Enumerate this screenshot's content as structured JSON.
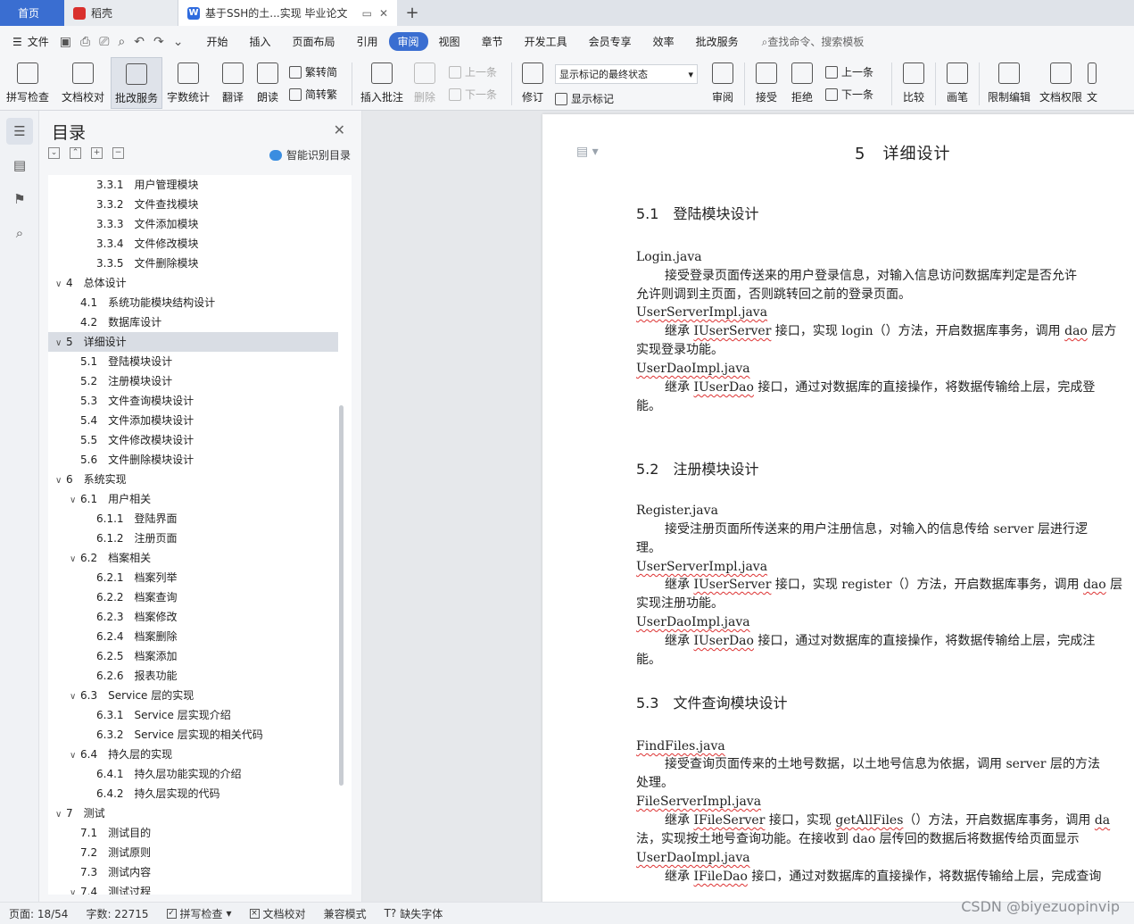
{
  "tabs": {
    "home": "首页",
    "daoke": "稻壳",
    "doc": "基于SSH的土...实现 毕业论文"
  },
  "menu": {
    "file": "文件",
    "items": [
      "开始",
      "插入",
      "页面布局",
      "引用",
      "审阅",
      "视图",
      "章节",
      "开发工具",
      "会员专享",
      "效率",
      "批改服务"
    ],
    "active": "审阅",
    "search": "查找命令、搜索模板"
  },
  "ribbon": {
    "spell": "拼写检查",
    "doccheck": "文档校对",
    "correct": "批改服务",
    "wordcount": "字数统计",
    "translate": "翻译",
    "read": "朗读",
    "trad": "繁转简",
    "simp": "简转繁",
    "insert_comment": "插入批注",
    "delete": "删除",
    "prev": "上一条",
    "next": "下一条",
    "revise": "修订",
    "mark_state": "显示标记的最终状态",
    "show_mark": "显示标记",
    "review": "审阅",
    "accept": "接受",
    "reject": "拒绝",
    "prev2": "上一条",
    "next2": "下一条",
    "compare": "比较",
    "pen": "画笔",
    "restrict": "限制编辑",
    "perm": "文档权限",
    "more": "文"
  },
  "nav": {
    "title": "目录",
    "smart": "智能识别目录",
    "toc": [
      {
        "level": 3,
        "num": "3.3.1",
        "text": "用户管理模块"
      },
      {
        "level": 3,
        "num": "3.3.2",
        "text": "文件查找模块"
      },
      {
        "level": 3,
        "num": "3.3.3",
        "text": "文件添加模块"
      },
      {
        "level": 3,
        "num": "3.3.4",
        "text": "文件修改模块"
      },
      {
        "level": 3,
        "num": "3.3.5",
        "text": "文件删除模块"
      },
      {
        "level": 1,
        "num": "4",
        "text": "总体设计",
        "toggle": "∨"
      },
      {
        "level": 2,
        "num": "4.1",
        "text": "系统功能模块结构设计"
      },
      {
        "level": 2,
        "num": "4.2",
        "text": "数据库设计"
      },
      {
        "level": 1,
        "num": "5",
        "text": "详细设计",
        "toggle": "∨",
        "selected": true
      },
      {
        "level": 2,
        "num": "5.1",
        "text": "登陆模块设计"
      },
      {
        "level": 2,
        "num": "5.2",
        "text": "注册模块设计"
      },
      {
        "level": 2,
        "num": "5.3",
        "text": "文件查询模块设计"
      },
      {
        "level": 2,
        "num": "5.4",
        "text": "文件添加模块设计"
      },
      {
        "level": 2,
        "num": "5.5",
        "text": "文件修改模块设计"
      },
      {
        "level": 2,
        "num": "5.6",
        "text": "文件删除模块设计"
      },
      {
        "level": 1,
        "num": "6",
        "text": "系统实现",
        "toggle": "∨"
      },
      {
        "level": 2,
        "num": "6.1",
        "text": "用户相关",
        "toggle": "∨"
      },
      {
        "level": 3,
        "num": "6.1.1",
        "text": "登陆界面"
      },
      {
        "level": 3,
        "num": "6.1.2",
        "text": "注册页面"
      },
      {
        "level": 2,
        "num": "6.2",
        "text": "档案相关",
        "toggle": "∨"
      },
      {
        "level": 3,
        "num": "6.2.1",
        "text": "档案列举"
      },
      {
        "level": 3,
        "num": "6.2.2",
        "text": "档案查询"
      },
      {
        "level": 3,
        "num": "6.2.3",
        "text": "档案修改"
      },
      {
        "level": 3,
        "num": "6.2.4",
        "text": "档案删除"
      },
      {
        "level": 3,
        "num": "6.2.5",
        "text": "档案添加"
      },
      {
        "level": 3,
        "num": "6.2.6",
        "text": "报表功能"
      },
      {
        "level": 2,
        "num": "6.3",
        "text": "Service 层的实现",
        "toggle": "∨"
      },
      {
        "level": 3,
        "num": "6.3.1",
        "text": "Service 层实现介绍"
      },
      {
        "level": 3,
        "num": "6.3.2",
        "text": "Service 层实现的相关代码"
      },
      {
        "level": 2,
        "num": "6.4",
        "text": "持久层的实现",
        "toggle": "∨"
      },
      {
        "level": 3,
        "num": "6.4.1",
        "text": "持久层功能实现的介绍"
      },
      {
        "level": 3,
        "num": "6.4.2",
        "text": "持久层实现的代码"
      },
      {
        "level": 1,
        "num": "7",
        "text": "测试",
        "toggle": "∨"
      },
      {
        "level": 2,
        "num": "7.1",
        "text": "测试目的"
      },
      {
        "level": 2,
        "num": "7.2",
        "text": "测试原则"
      },
      {
        "level": 2,
        "num": "7.3",
        "text": "测试内容"
      },
      {
        "level": 2,
        "num": "7.4",
        "text": "测试过程",
        "toggle": "∨"
      }
    ]
  },
  "doc": {
    "chapter": "5　详细设计",
    "s51": "5.1　登陆模块设计",
    "s52": "5.2　注册模块设计",
    "s53": "5.3　文件查询模块设计",
    "lines": [
      {
        "id": "l1",
        "text": "Login.java",
        "wavy": false
      },
      {
        "id": "l2",
        "text": "接受登录页面传送来的用户登录信息，对输入信息访问数据库判定是否允许",
        "indent": true
      },
      {
        "id": "l3",
        "text": "允许则调到主页面，否则跳转回之前的登录页面。"
      },
      {
        "id": "l4",
        "text": "UserServerImpl.java",
        "wavy": true
      },
      {
        "id": "l5a",
        "text": "继承 ",
        "indent": true
      },
      {
        "id": "l6",
        "text": "实现登录功能。"
      },
      {
        "id": "l7",
        "text": "UserDaoImpl.java",
        "wavy": true
      },
      {
        "id": "l9",
        "text": "能。"
      },
      {
        "id": "m1",
        "text": "Register.java"
      },
      {
        "id": "m2",
        "text": "接受注册页面所传送来的用户注册信息，对输入的信息传给 server 层进行逻",
        "indent": true
      },
      {
        "id": "m3",
        "text": "理。"
      },
      {
        "id": "m4",
        "text": "UserServerImpl.java",
        "wavy": true
      },
      {
        "id": "m6",
        "text": "实现注册功能。"
      },
      {
        "id": "m7",
        "text": "UserDaoImpl.java",
        "wavy": true
      },
      {
        "id": "m9",
        "text": "能。"
      },
      {
        "id": "n1",
        "text": "FindFiles.java",
        "wavy": true
      },
      {
        "id": "n2",
        "text": "接受查询页面传来的土地号数据，以土地号信息为依据，调用 server 层的方法",
        "indent": true
      },
      {
        "id": "n3",
        "text": "处理。"
      },
      {
        "id": "n4",
        "text": "FileServerImpl.java",
        "wavy": true
      },
      {
        "id": "n6",
        "text": "法，实现按土地号查询功能。在接收到 dao 层传回的数据后将数据传给页面显示"
      },
      {
        "id": "n7",
        "text": "UserDaoImpl.java",
        "wavy": true
      }
    ],
    "l5": {
      "pre": "继承 ",
      "w1": "IUserServer",
      "mid": " 接口，实现 login（）方法，开启数据库事务，调用 ",
      "w2": "dao",
      "post": " 层方"
    },
    "l8": {
      "pre": "继承 ",
      "w1": "IUserDao",
      "post": " 接口，通过对数据库的直接操作，将数据传输给上层，完成登"
    },
    "m5": {
      "pre": "继承 ",
      "w1": "IUserServer",
      "mid": " 接口，实现 register（）方法，开启数据库事务，调用 ",
      "w2": "dao",
      "post": " 层"
    },
    "m8": {
      "pre": "继承 ",
      "w1": "IUserDao",
      "post": " 接口，通过对数据库的直接操作，将数据传输给上层，完成注"
    },
    "n5": {
      "pre": "继承 ",
      "w1": "IFileServer",
      "mid": " 接口，实现 ",
      "w2": "getAllFiles",
      "mid2": "（）方法，开启数据库事务，调用 ",
      "w3": "da"
    },
    "n8": {
      "pre": "继承 ",
      "w1": "IFileDao",
      "post": " 接口，通过对数据库的直接操作，将数据传输给上层，完成查询"
    }
  },
  "status": {
    "page": "页面: 18/54",
    "words": "字数: 22715",
    "spell": "拼写检查",
    "doccheck": "文档校对",
    "compat": "兼容模式",
    "missing_font": "缺失字体"
  },
  "watermark": "CSDN @biyezuopinvip"
}
